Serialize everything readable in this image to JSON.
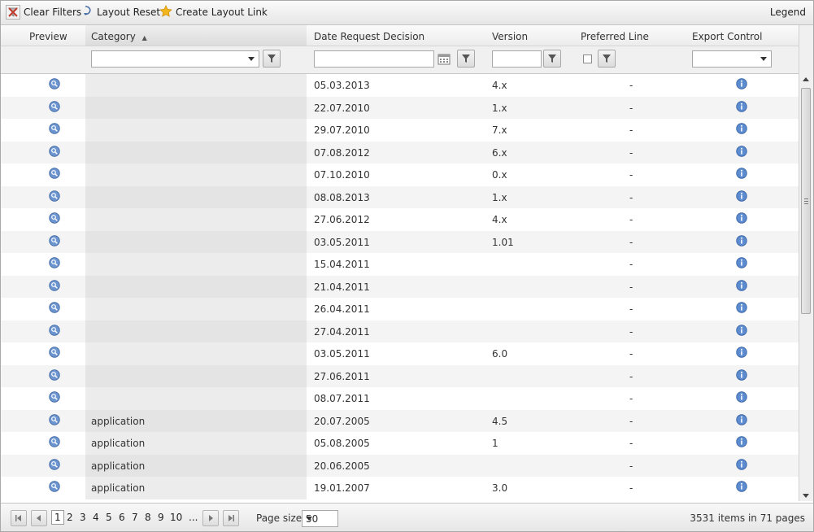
{
  "toolbar": {
    "clear_filters": "Clear Filters",
    "layout_reset": "Layout Reset",
    "create_layout_link": "Create Layout Link",
    "legend": "Legend"
  },
  "columns": {
    "preview": "Preview",
    "category": "Category",
    "date": "Date Request Decision",
    "version": "Version",
    "preferred": "Preferred Line",
    "export": "Export Control"
  },
  "filters": {
    "category_value": "",
    "date_value": "",
    "version_value": "",
    "export_value": ""
  },
  "rows": [
    {
      "category": "",
      "date": "05.03.2013",
      "version": "4.x",
      "preferred": "-"
    },
    {
      "category": "",
      "date": "22.07.2010",
      "version": "1.x",
      "preferred": "-"
    },
    {
      "category": "",
      "date": "29.07.2010",
      "version": "7.x",
      "preferred": "-"
    },
    {
      "category": "",
      "date": "07.08.2012",
      "version": "6.x",
      "preferred": "-"
    },
    {
      "category": "",
      "date": "07.10.2010",
      "version": "0.x",
      "preferred": "-"
    },
    {
      "category": "",
      "date": "08.08.2013",
      "version": "1.x",
      "preferred": "-"
    },
    {
      "category": "",
      "date": "27.06.2012",
      "version": "4.x",
      "preferred": "-"
    },
    {
      "category": "",
      "date": "03.05.2011",
      "version": "1.01",
      "preferred": "-"
    },
    {
      "category": "",
      "date": "15.04.2011",
      "version": "",
      "preferred": "-"
    },
    {
      "category": "",
      "date": "21.04.2011",
      "version": "",
      "preferred": "-"
    },
    {
      "category": "",
      "date": "26.04.2011",
      "version": "",
      "preferred": "-"
    },
    {
      "category": "",
      "date": "27.04.2011",
      "version": "",
      "preferred": "-"
    },
    {
      "category": "",
      "date": "03.05.2011",
      "version": "6.0",
      "preferred": "-"
    },
    {
      "category": "",
      "date": "27.06.2011",
      "version": "",
      "preferred": "-"
    },
    {
      "category": "",
      "date": "08.07.2011",
      "version": "",
      "preferred": "-"
    },
    {
      "category": "application",
      "date": "20.07.2005",
      "version": "4.5",
      "preferred": "-"
    },
    {
      "category": "application",
      "date": "05.08.2005",
      "version": "1",
      "preferred": "-"
    },
    {
      "category": "application",
      "date": "20.06.2005",
      "version": "",
      "preferred": "-"
    },
    {
      "category": "application",
      "date": "19.01.2007",
      "version": "3.0",
      "preferred": "-"
    }
  ],
  "pager": {
    "pages": [
      "1",
      "2",
      "3",
      "4",
      "5",
      "6",
      "7",
      "8",
      "9",
      "10",
      "..."
    ],
    "current": "1",
    "page_size_label": "Page size:",
    "page_size": "50",
    "summary": "3531 items in 71 pages"
  },
  "colors": {
    "preview_icon": "#5b86c4",
    "info_icon": "#4f7fc8",
    "clear_icon": "#c0392b",
    "star": "#f2b61c"
  }
}
